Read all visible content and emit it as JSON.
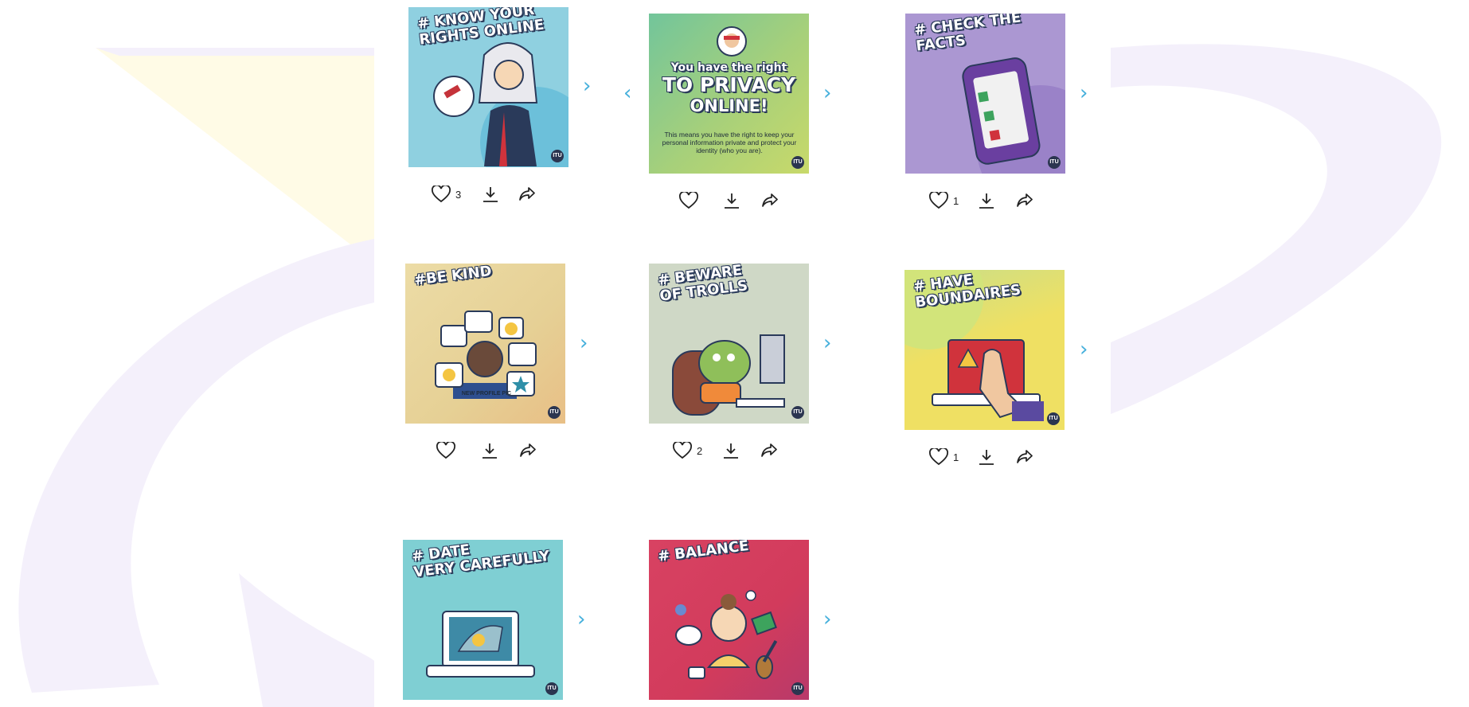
{
  "colors": {
    "arrow": "#46b0dc",
    "background_shape": "#f3f0fa",
    "flag_yellow": "#fffbe6"
  },
  "cards": [
    {
      "id": "know-rights",
      "tag": "# Know your\nrights online",
      "likes": "3",
      "bg": "#8fd0e0"
    },
    {
      "id": "privacy",
      "title_line1": "You have the right",
      "title_line2": "TO PRIVACY",
      "title_line3": "ONLINE!",
      "body": "This means you have the right to keep your personal information private and protect your identity (who you are).",
      "likes": "",
      "bg": "#a7d07a"
    },
    {
      "id": "check-facts",
      "tag": "# Check the\nfacts",
      "likes": "1",
      "bg": "#ab97d2"
    },
    {
      "id": "be-kind",
      "tag": "#Be Kind",
      "likes": "",
      "profile_label": "NEW PROFILE PIC",
      "bg": "#ead8a4"
    },
    {
      "id": "beware-trolls",
      "tag": "# Beware\nof trolls",
      "likes": "2",
      "bg": "#cfd8c6"
    },
    {
      "id": "boundaries",
      "tag": "# Have\nboundaires",
      "likes": "1",
      "bg": "#efe063"
    },
    {
      "id": "date-carefully",
      "tag": "# Date\nvery carefully",
      "bg": "#7fcfd3"
    },
    {
      "id": "balance",
      "tag": "# Balance",
      "bg": "#d84262"
    }
  ],
  "icons": {
    "like": "heart-icon",
    "download": "download-icon",
    "share": "share-icon",
    "next": "chevron-right-icon",
    "prev": "chevron-left-icon",
    "logo": "org-logo"
  },
  "glyphs": {
    "next": "›",
    "prev": "‹",
    "logo": "ITU"
  }
}
